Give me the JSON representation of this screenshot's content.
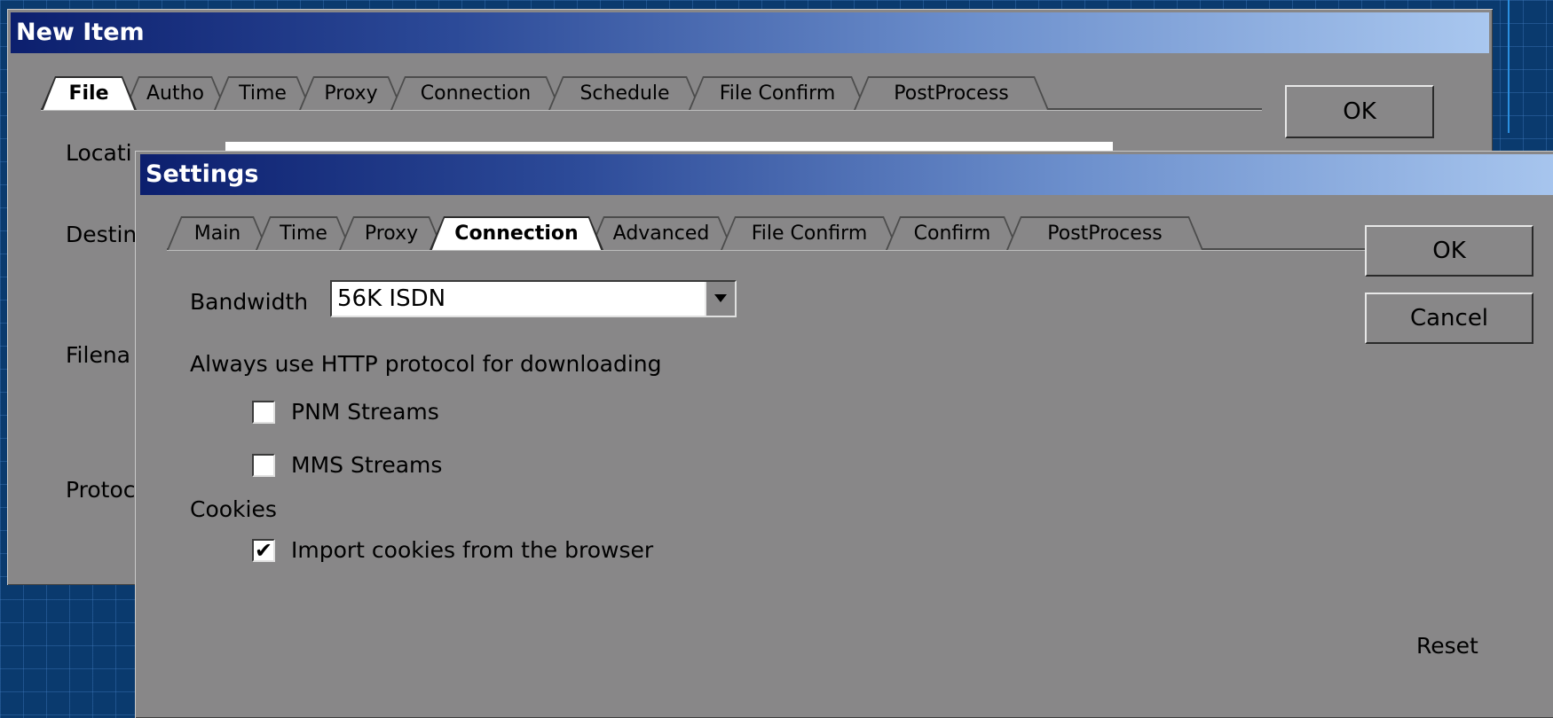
{
  "new_item": {
    "title": "New Item",
    "tabs": [
      "File",
      "Autho",
      "Time",
      "Proxy",
      "Connection",
      "Schedule",
      "File Confirm",
      "PostProcess"
    ],
    "active_tab": "File",
    "ok_label": "OK",
    "field_labels": [
      "Locati",
      "Destin",
      "Filena",
      "Protoc"
    ]
  },
  "settings": {
    "title": "Settings",
    "tabs": [
      "Main",
      "Time",
      "Proxy",
      "Connection",
      "Advanced",
      "File Confirm",
      "Confirm",
      "PostProcess"
    ],
    "active_tab": "Connection",
    "ok_label": "OK",
    "cancel_label": "Cancel",
    "reset_label": "Reset",
    "bandwidth": {
      "label": "Bandwidth",
      "value": "56K ISDN"
    },
    "http_section_label": "Always use HTTP protocol for downloading",
    "pnm": {
      "label": "PNM Streams",
      "checked": false
    },
    "mms": {
      "label": "MMS Streams",
      "checked": false
    },
    "cookies_label": "Cookies",
    "import_cookies": {
      "label": "Import cookies from the browser",
      "checked": true,
      "check_glyph": "✔"
    }
  },
  "colors": {
    "dialog_bg": "#888788",
    "title_gradient_start": "#0c1f6e",
    "title_gradient_end": "#a9c7ef",
    "desktop": "#0a3a6e"
  }
}
